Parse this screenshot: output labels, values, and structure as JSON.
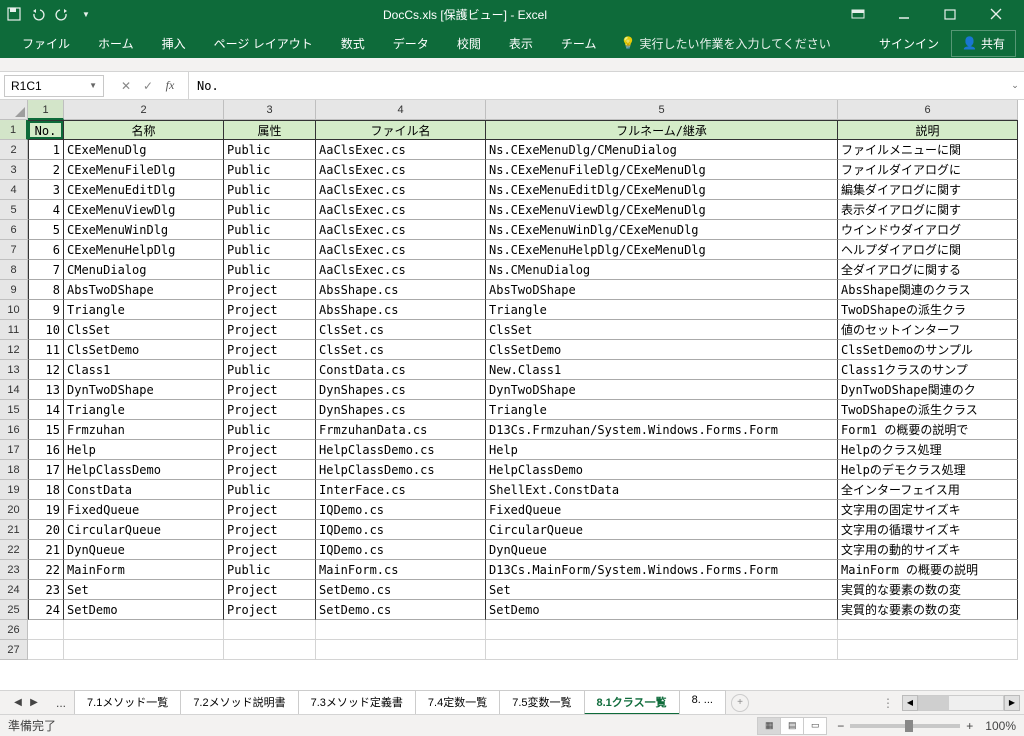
{
  "title": "DocCs.xls  [保護ビュー] - Excel",
  "qat": {
    "save": "save",
    "undo": "undo",
    "redo": "redo"
  },
  "ribbon_tabs": [
    "ファイル",
    "ホーム",
    "挿入",
    "ページ レイアウト",
    "数式",
    "データ",
    "校閲",
    "表示",
    "チーム"
  ],
  "tell_me": "実行したい作業を入力してください",
  "signin": "サインイン",
  "share": "共有",
  "name_box": "R1C1",
  "formula": "No.",
  "col_headers": [
    "1",
    "2",
    "3",
    "4",
    "5",
    "6"
  ],
  "row_headers": [
    "1",
    "2",
    "3",
    "4",
    "5",
    "6",
    "7",
    "8",
    "9",
    "10",
    "11",
    "12",
    "13",
    "14",
    "15",
    "16",
    "17",
    "18",
    "19",
    "20",
    "21",
    "22",
    "23",
    "24",
    "25",
    "26",
    "27"
  ],
  "headers": [
    "No.",
    "名称",
    "属性",
    "ファイル名",
    "フルネーム/継承",
    "説明"
  ],
  "rows": [
    {
      "no": "1",
      "name": "CExeMenuDlg",
      "attr": "Public",
      "file": "AaClsExec.cs",
      "full": "Ns.CExeMenuDlg/CMenuDialog",
      "desc": "ファイルメニューに関"
    },
    {
      "no": "2",
      "name": "CExeMenuFileDlg",
      "attr": "Public",
      "file": "AaClsExec.cs",
      "full": "Ns.CExeMenuFileDlg/CExeMenuDlg",
      "desc": "ファイルダイアログに"
    },
    {
      "no": "3",
      "name": "CExeMenuEditDlg",
      "attr": "Public",
      "file": "AaClsExec.cs",
      "full": "Ns.CExeMenuEditDlg/CExeMenuDlg",
      "desc": "編集ダイアログに関す"
    },
    {
      "no": "4",
      "name": "CExeMenuViewDlg",
      "attr": "Public",
      "file": "AaClsExec.cs",
      "full": "Ns.CExeMenuViewDlg/CExeMenuDlg",
      "desc": "表示ダイアログに関す"
    },
    {
      "no": "5",
      "name": "CExeMenuWinDlg",
      "attr": "Public",
      "file": "AaClsExec.cs",
      "full": "Ns.CExeMenuWinDlg/CExeMenuDlg",
      "desc": "ウインドウダイアログ"
    },
    {
      "no": "6",
      "name": "CExeMenuHelpDlg",
      "attr": "Public",
      "file": "AaClsExec.cs",
      "full": "Ns.CExeMenuHelpDlg/CExeMenuDlg",
      "desc": "ヘルプダイアログに関"
    },
    {
      "no": "7",
      "name": "CMenuDialog",
      "attr": "Public",
      "file": "AaClsExec.cs",
      "full": "Ns.CMenuDialog",
      "desc": "全ダイアログに関する"
    },
    {
      "no": "8",
      "name": "AbsTwoDShape",
      "attr": "Project",
      "file": "AbsShape.cs",
      "full": "AbsTwoDShape",
      "desc": "AbsShape関連のクラス"
    },
    {
      "no": "9",
      "name": "Triangle",
      "attr": "Project",
      "file": "AbsShape.cs",
      "full": "Triangle",
      "desc": "TwoDShapeの派生クラ"
    },
    {
      "no": "10",
      "name": "ClsSet",
      "attr": "Project",
      "file": "ClsSet.cs",
      "full": "ClsSet",
      "desc": "値のセットインターフ"
    },
    {
      "no": "11",
      "name": "ClsSetDemo",
      "attr": "Project",
      "file": "ClsSet.cs",
      "full": "ClsSetDemo",
      "desc": "ClsSetDemoのサンプル"
    },
    {
      "no": "12",
      "name": "Class1",
      "attr": "Public",
      "file": "ConstData.cs",
      "full": "New.Class1",
      "desc": "Class1クラスのサンプ"
    },
    {
      "no": "13",
      "name": "DynTwoDShape",
      "attr": "Project",
      "file": "DynShapes.cs",
      "full": "DynTwoDShape",
      "desc": "DynTwoDShape関連のク"
    },
    {
      "no": "14",
      "name": "Triangle",
      "attr": "Project",
      "file": "DynShapes.cs",
      "full": "Triangle",
      "desc": "TwoDShapeの派生クラス"
    },
    {
      "no": "15",
      "name": "Frmzuhan",
      "attr": "Public",
      "file": "FrmzuhanData.cs",
      "full": "D13Cs.Frmzuhan/System.Windows.Forms.Form",
      "desc": "Form1 の概要の説明で"
    },
    {
      "no": "16",
      "name": "Help",
      "attr": "Project",
      "file": "HelpClassDemo.cs",
      "full": "Help",
      "desc": "Helpのクラス処理"
    },
    {
      "no": "17",
      "name": "HelpClassDemo",
      "attr": "Project",
      "file": "HelpClassDemo.cs",
      "full": "HelpClassDemo",
      "desc": "Helpのデモクラス処理"
    },
    {
      "no": "18",
      "name": "ConstData",
      "attr": "Public",
      "file": "InterFace.cs",
      "full": "ShellExt.ConstData",
      "desc": "全インターフェイス用"
    },
    {
      "no": "19",
      "name": "FixedQueue",
      "attr": "Project",
      "file": "IQDemo.cs",
      "full": "FixedQueue",
      "desc": "文字用の固定サイズキ"
    },
    {
      "no": "20",
      "name": "CircularQueue",
      "attr": "Project",
      "file": "IQDemo.cs",
      "full": "CircularQueue",
      "desc": "文字用の循環サイズキ"
    },
    {
      "no": "21",
      "name": "DynQueue",
      "attr": "Project",
      "file": "IQDemo.cs",
      "full": "DynQueue",
      "desc": "文字用の動的サイズキ"
    },
    {
      "no": "22",
      "name": "MainForm",
      "attr": "Public",
      "file": "MainForm.cs",
      "full": "D13Cs.MainForm/System.Windows.Forms.Form",
      "desc": "MainForm の概要の説明"
    },
    {
      "no": "23",
      "name": "Set",
      "attr": "Project",
      "file": "SetDemo.cs",
      "full": "Set",
      "desc": "実質的な要素の数の変"
    },
    {
      "no": "24",
      "name": "SetDemo",
      "attr": "Project",
      "file": "SetDemo.cs",
      "full": "SetDemo",
      "desc": "実質的な要素の数の変"
    }
  ],
  "sheet_tabs": [
    "7.1メソッド一覧",
    "7.2メソッド説明書",
    "7.3メソッド定義書",
    "7.4定数一覧",
    "7.5変数一覧",
    "8.1クラス一覧",
    "8. ..."
  ],
  "active_tab": 5,
  "tab_prefix": "...",
  "status": "準備完了",
  "zoom": "100%"
}
